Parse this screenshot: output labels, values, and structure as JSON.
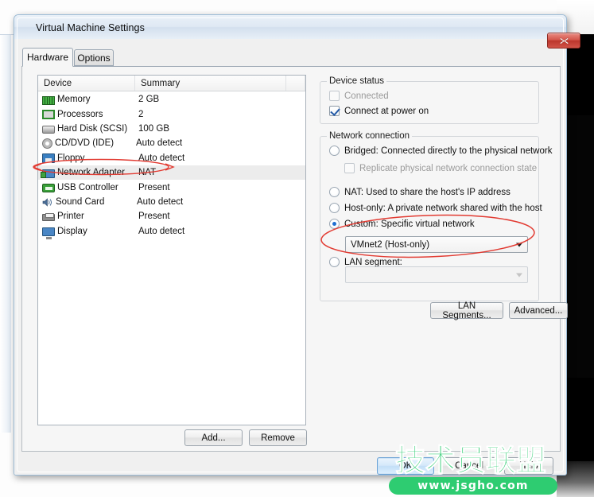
{
  "window": {
    "title": "Virtual Machine Settings",
    "close_label": "Close",
    "close_icon": "close-icon"
  },
  "tabs": [
    {
      "label": "Hardware",
      "active": true
    },
    {
      "label": "Options",
      "active": false
    }
  ],
  "device_list": {
    "columns": [
      "Device",
      "Summary",
      ""
    ],
    "rows": [
      {
        "icon": "memory-icon",
        "device": "Memory",
        "summary": "2 GB",
        "selected": false
      },
      {
        "icon": "processor-icon",
        "device": "Processors",
        "summary": "2",
        "selected": false
      },
      {
        "icon": "hard-disk-icon",
        "device": "Hard Disk (SCSI)",
        "summary": "100 GB",
        "selected": false
      },
      {
        "icon": "cd-dvd-icon",
        "device": "CD/DVD (IDE)",
        "summary": "Auto detect",
        "selected": false
      },
      {
        "icon": "floppy-icon",
        "device": "Floppy",
        "summary": "Auto detect",
        "selected": false
      },
      {
        "icon": "network-adapter-icon",
        "device": "Network Adapter",
        "summary": "NAT",
        "selected": true
      },
      {
        "icon": "usb-controller-icon",
        "device": "USB Controller",
        "summary": "Present",
        "selected": false
      },
      {
        "icon": "sound-card-icon",
        "device": "Sound Card",
        "summary": "Auto detect",
        "selected": false
      },
      {
        "icon": "printer-icon",
        "device": "Printer",
        "summary": "Present",
        "selected": false
      },
      {
        "icon": "display-icon",
        "device": "Display",
        "summary": "Auto detect",
        "selected": false
      }
    ],
    "add_label": "Add...",
    "remove_label": "Remove"
  },
  "device_status": {
    "legend": "Device status",
    "connected": {
      "label": "Connected",
      "checked": false,
      "disabled": true
    },
    "connect_at_power_on": {
      "label": "Connect at power on",
      "checked": true,
      "disabled": false
    }
  },
  "network_connection": {
    "legend": "Network connection",
    "options": [
      {
        "label": "Bridged: Connected directly to the physical network",
        "selected": false
      },
      {
        "label": "NAT: Used to share the host's IP address",
        "selected": false
      },
      {
        "label": "Host-only: A private network shared with the host",
        "selected": false
      },
      {
        "label": "Custom: Specific virtual network",
        "selected": true
      },
      {
        "label": "LAN segment:",
        "selected": false
      }
    ],
    "replicate": {
      "label": "Replicate physical network connection state",
      "checked": false,
      "disabled": true
    },
    "custom_network": {
      "value": "VMnet2 (Host-only)",
      "disabled": false
    },
    "lan_segment": {
      "value": "",
      "disabled": true
    },
    "lan_segments_button": "LAN Segments...",
    "advanced_button": "Advanced..."
  },
  "dialog_buttons": {
    "ok": "OK",
    "cancel": "Cancel",
    "help": "Help"
  },
  "annotations": {
    "highlight_color": "#e23b32",
    "ellipse_device_row": "Network Adapter NAT",
    "ellipse_custom_network": "Custom: Specific virtual network VMnet2 (Host-only)"
  },
  "watermark": {
    "brand": "技术员联盟",
    "url": "www.jsgho.com",
    "color": "#2ecc71"
  }
}
